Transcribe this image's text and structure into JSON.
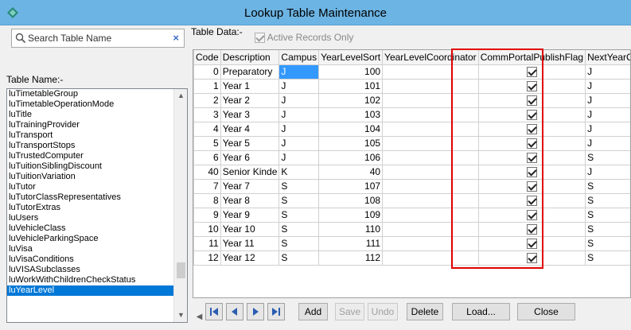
{
  "window": {
    "title": "Lookup Table Maintenance"
  },
  "search": {
    "placeholder": "Search Table Name",
    "clear_glyph": "×"
  },
  "table_name_label": "Table Name:-",
  "table_names": [
    "luTimetableGroup",
    "luTimetableOperationMode",
    "luTitle",
    "luTrainingProvider",
    "luTransport",
    "luTransportStops",
    "luTrustedComputer",
    "luTuitionSiblingDiscount",
    "luTuitionVariation",
    "luTutor",
    "luTutorClassRepresentatives",
    "luTutorExtras",
    "luUsers",
    "luVehicleClass",
    "luVehicleParkingSpace",
    "luVisa",
    "luVisaConditions",
    "luVISASubclasses",
    "luWorkWithChildrenCheckStatus",
    "luYearLevel"
  ],
  "selected_table": "luYearLevel",
  "table_data_label": "Table Data:-",
  "active_records": {
    "label": "Active Records Only",
    "checked": true
  },
  "columns": [
    "Code",
    "Description",
    "Campus",
    "YearLevelSort",
    "YearLevelCoordinator",
    "CommPortalPublishFlag",
    "NextYearCampusMale"
  ],
  "rows": [
    {
      "code": "0",
      "description": "Preparatory",
      "campus": "J",
      "sort": "100",
      "coordinator": "",
      "publish": true,
      "next_male": "J"
    },
    {
      "code": "1",
      "description": "Year 1",
      "campus": "J",
      "sort": "101",
      "coordinator": "",
      "publish": true,
      "next_male": "J"
    },
    {
      "code": "2",
      "description": "Year 2",
      "campus": "J",
      "sort": "102",
      "coordinator": "",
      "publish": true,
      "next_male": "J"
    },
    {
      "code": "3",
      "description": "Year 3",
      "campus": "J",
      "sort": "103",
      "coordinator": "",
      "publish": true,
      "next_male": "J"
    },
    {
      "code": "4",
      "description": "Year 4",
      "campus": "J",
      "sort": "104",
      "coordinator": "",
      "publish": true,
      "next_male": "J"
    },
    {
      "code": "5",
      "description": "Year 5",
      "campus": "J",
      "sort": "105",
      "coordinator": "",
      "publish": true,
      "next_male": "J"
    },
    {
      "code": "6",
      "description": "Year 6",
      "campus": "J",
      "sort": "106",
      "coordinator": "",
      "publish": true,
      "next_male": "S"
    },
    {
      "code": "40",
      "description": "Senior Kinde",
      "campus": "K",
      "sort": "40",
      "coordinator": "",
      "publish": true,
      "next_male": "J"
    },
    {
      "code": "7",
      "description": "Year 7",
      "campus": "S",
      "sort": "107",
      "coordinator": "",
      "publish": true,
      "next_male": "S"
    },
    {
      "code": "8",
      "description": "Year 8",
      "campus": "S",
      "sort": "108",
      "coordinator": "",
      "publish": true,
      "next_male": "S"
    },
    {
      "code": "9",
      "description": "Year 9",
      "campus": "S",
      "sort": "109",
      "coordinator": "",
      "publish": true,
      "next_male": "S"
    },
    {
      "code": "10",
      "description": "Year 10",
      "campus": "S",
      "sort": "110",
      "coordinator": "",
      "publish": true,
      "next_male": "S"
    },
    {
      "code": "11",
      "description": "Year 11",
      "campus": "S",
      "sort": "111",
      "coordinator": "",
      "publish": true,
      "next_male": "S"
    },
    {
      "code": "12",
      "description": "Year 12",
      "campus": "S",
      "sort": "112",
      "coordinator": "",
      "publish": true,
      "next_male": "S"
    }
  ],
  "buttons": {
    "add": "Add",
    "save": "Save",
    "undo": "Undo",
    "delete": "Delete",
    "load": "Load...",
    "close": "Close"
  },
  "colors": {
    "titlebar": "#6cb4e3",
    "selection": "#0078d7",
    "highlight_box": "#e00000"
  }
}
